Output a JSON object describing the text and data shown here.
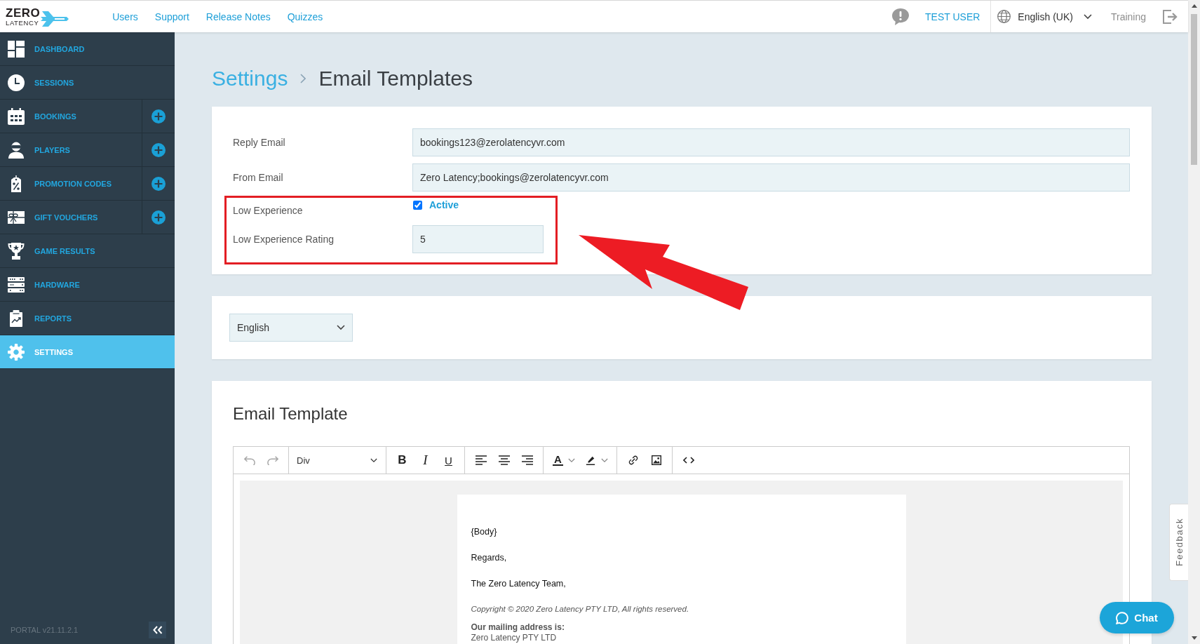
{
  "top_bar": {
    "logo": {
      "line_1": "ZERO",
      "line_2": "LATENCY"
    },
    "links": [
      "Users",
      "Support",
      "Release Notes",
      "Quizzes"
    ],
    "user": "TEST USER",
    "language": "English (UK)",
    "training": "Training"
  },
  "sidebar": {
    "items": [
      {
        "label": "DASHBOARD",
        "add": false,
        "selected": false
      },
      {
        "label": "SESSIONS",
        "add": false,
        "selected": false
      },
      {
        "label": "BOOKINGS",
        "add": true,
        "selected": false
      },
      {
        "label": "PLAYERS",
        "add": true,
        "selected": false
      },
      {
        "label": "PROMOTION CODES",
        "add": true,
        "selected": false
      },
      {
        "label": "GIFT VOUCHERS",
        "add": true,
        "selected": false
      },
      {
        "label": "GAME RESULTS",
        "add": false,
        "selected": false
      },
      {
        "label": "HARDWARE",
        "add": false,
        "selected": false
      },
      {
        "label": "REPORTS",
        "add": false,
        "selected": false
      },
      {
        "label": "SETTINGS",
        "add": false,
        "selected": true
      }
    ],
    "version": "PORTAL v21.11.2.1"
  },
  "breadcrumb": [
    {
      "label": "Settings",
      "current": false
    },
    {
      "label": "Email Templates",
      "current": true
    }
  ],
  "settings_form": {
    "fields": [
      {
        "kind": "text",
        "label": "Reply Email",
        "value": "bookings123@zerolatencyvr.com"
      },
      {
        "kind": "text",
        "label": "From Email",
        "value": "Zero Latency;bookings@zerolatencyvr.com"
      },
      {
        "kind": "checkbox",
        "label": "Low Experience",
        "option": "Active",
        "checked": true
      },
      {
        "kind": "number",
        "label": "Low Experience Rating",
        "value": "5"
      }
    ]
  },
  "language_select": {
    "value": "English"
  },
  "email_template": {
    "title": "Email Template",
    "toolbar": {
      "groups": [
        {
          "buttons": [
            {
              "kind": "undo",
              "disabled": true
            },
            {
              "kind": "redo",
              "disabled": true
            }
          ]
        },
        {
          "buttons": [
            {
              "kind": "block-format",
              "value": "Div",
              "disabled": false
            }
          ]
        },
        {
          "buttons": [
            {
              "kind": "bold",
              "label": "B",
              "disabled": false
            },
            {
              "kind": "italic",
              "label": "I",
              "disabled": false
            },
            {
              "kind": "underline",
              "label": "U",
              "disabled": false
            }
          ]
        },
        {
          "buttons": [
            {
              "kind": "align-left",
              "disabled": false
            },
            {
              "kind": "align-center",
              "disabled": false
            },
            {
              "kind": "align-right",
              "disabled": false
            }
          ]
        },
        {
          "buttons": [
            {
              "kind": "text-color",
              "label": "A",
              "disabled": false
            },
            {
              "kind": "highlight",
              "disabled": false
            }
          ]
        },
        {
          "buttons": [
            {
              "kind": "link",
              "disabled": false
            },
            {
              "kind": "image",
              "disabled": false
            }
          ]
        },
        {
          "buttons": [
            {
              "kind": "code",
              "disabled": false
            }
          ]
        }
      ]
    },
    "body": [
      {
        "kind": "paragraph",
        "text": "{Body}"
      },
      {
        "kind": "paragraph",
        "text": "Regards,"
      },
      {
        "kind": "paragraph",
        "text": "The Zero Latency Team,"
      },
      {
        "kind": "copyright",
        "text": "Copyright © 2020 Zero Latency PTY LTD, All rights reserved."
      },
      {
        "kind": "address-heading",
        "text": "Our mailing address is:"
      },
      {
        "kind": "address-line",
        "text": "Zero Latency PTY LTD"
      }
    ]
  },
  "feedback_tab": {
    "label": "Feedback"
  },
  "chat_button": {
    "label": "Chat"
  }
}
